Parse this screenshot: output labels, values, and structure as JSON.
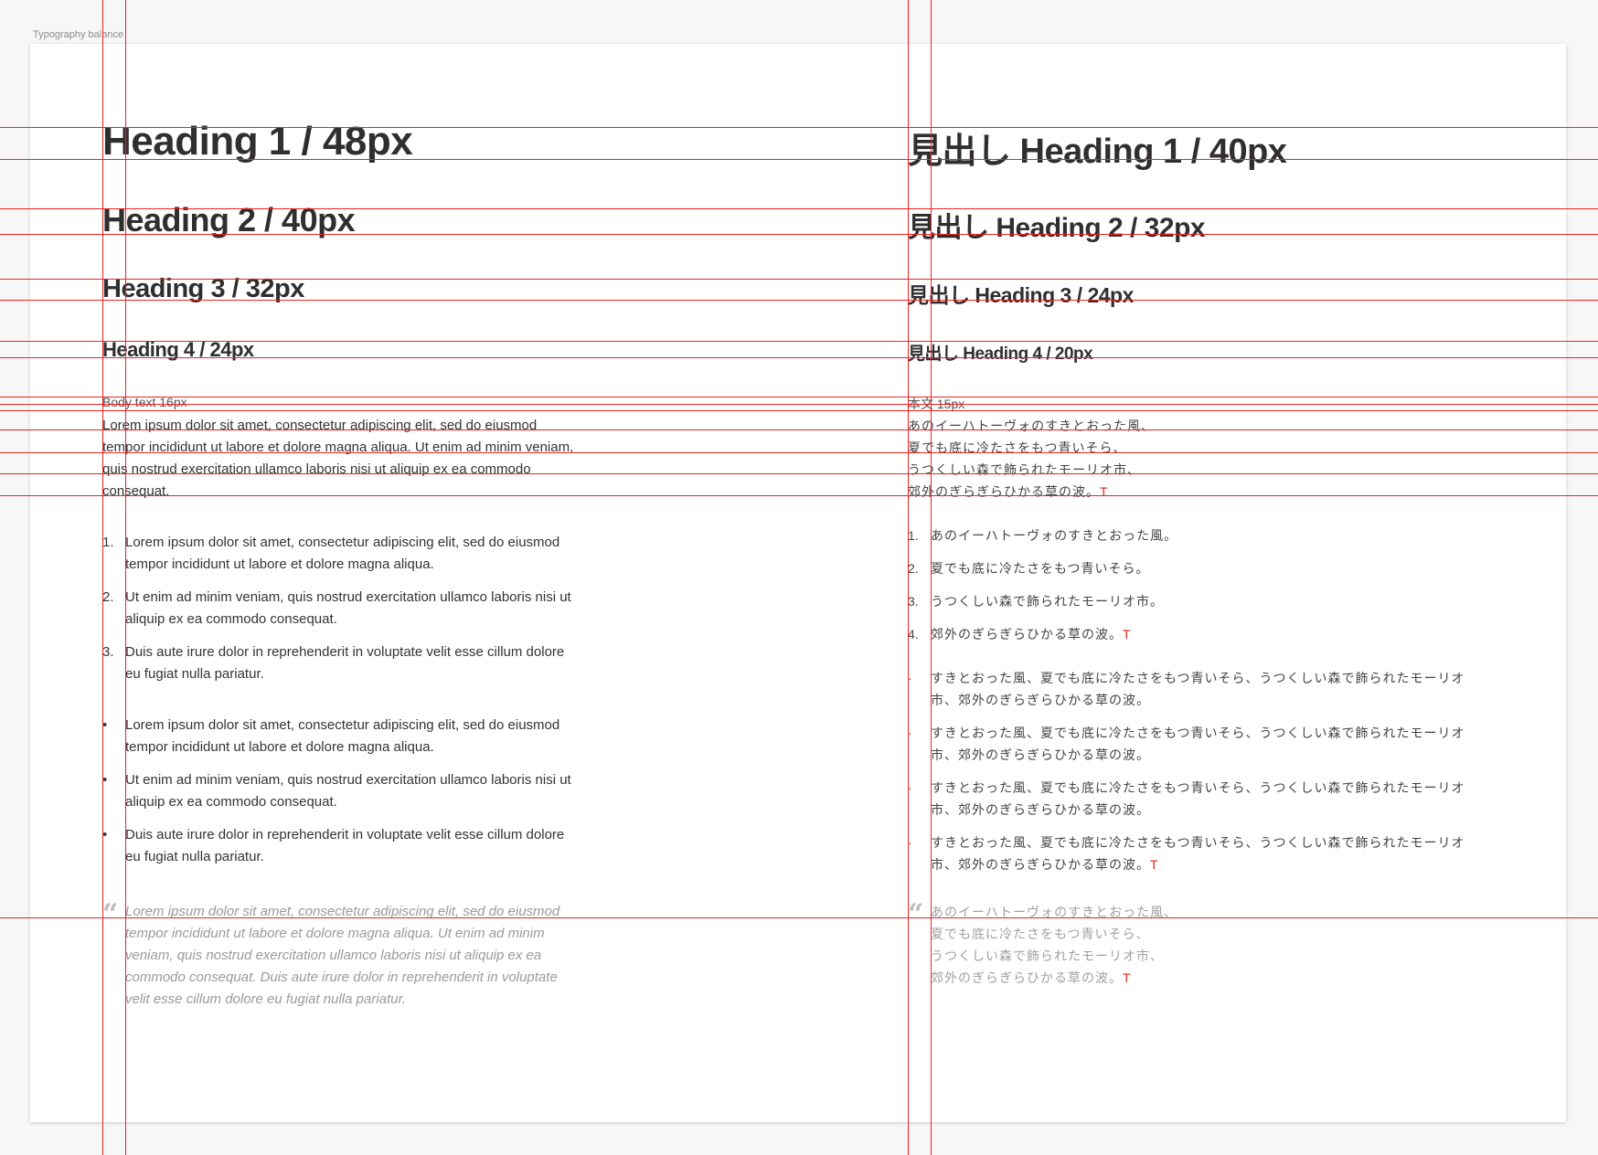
{
  "frame": {
    "label": "Typography balance"
  },
  "colors": {
    "guide": "#ee2222",
    "text": "#333333",
    "quote": "#9a9a9a",
    "accent": "#e0261b"
  },
  "left": {
    "h1": "Heading 1 / 48px",
    "h2": "Heading 2 / 40px",
    "h3": "Heading 3 / 32px",
    "h4": "Heading 4 / 24px",
    "body_label": "Body text 16px",
    "body": "Lorem ipsum dolor sit amet, consectetur adipiscing elit, sed do eiusmod tempor incididunt ut labore et dolore magna aliqua. Ut enim ad minim veniam, quis nostrud exercitation ullamco laboris nisi ut aliquip ex ea commodo consequat.",
    "ordered": [
      {
        "marker": "1.",
        "text": "Lorem ipsum dolor sit amet, consectetur adipiscing elit, sed do eiusmod tempor incididunt ut labore et dolore magna aliqua."
      },
      {
        "marker": "2.",
        "text": "Ut enim ad minim veniam, quis nostrud exercitation ullamco laboris nisi ut aliquip ex ea commodo consequat."
      },
      {
        "marker": "3.",
        "text": "Duis aute irure dolor in reprehenderit in voluptate velit esse cillum dolore eu fugiat nulla pariatur."
      }
    ],
    "bullets": [
      {
        "marker": "•",
        "text": "Lorem ipsum dolor sit amet, consectetur adipiscing elit, sed do eiusmod tempor incididunt ut labore et dolore magna aliqua."
      },
      {
        "marker": "•",
        "text": "Ut enim ad minim veniam, quis nostrud exercitation ullamco laboris nisi ut aliquip ex ea commodo consequat."
      },
      {
        "marker": "•",
        "text": "Duis aute irure dolor in reprehenderit in voluptate velit esse cillum dolore eu fugiat nulla pariatur."
      }
    ],
    "quote_mark": "“",
    "quote": "Lorem ipsum dolor sit amet, consectetur adipiscing elit, sed do eiusmod tempor incididunt ut labore et dolore magna aliqua. Ut enim ad minim veniam, quis nostrud exercitation ullamco laboris nisi ut aliquip ex ea commodo consequat. Duis aute irure dolor in reprehenderit in voluptate velit esse cillum dolore eu fugiat nulla pariatur."
  },
  "right": {
    "h1": "見出し Heading 1 / 40px",
    "h2": "見出し Heading 2 / 32px",
    "h3": "見出し Heading 3 / 24px",
    "h4": "見出し Heading 4 / 20px",
    "body_label": "本文 15px",
    "body_lines": [
      "あのイーハトーヴォのすきとおった風、",
      "夏でも底に冷たさをもつ青いそら、",
      "うつくしい森で飾られたモーリオ市、",
      "郊外のぎらぎらひかる草の波。"
    ],
    "t_mark": "T",
    "ordered": [
      {
        "marker": "1.",
        "text": "あのイーハトーヴォのすきとおった風。"
      },
      {
        "marker": "2.",
        "text": "夏でも底に冷たさをもつ青いそら。"
      },
      {
        "marker": "3.",
        "text": "うつくしい森で飾られたモーリオ市。"
      },
      {
        "marker": "4.",
        "text": "郊外のぎらぎらひかる草の波。"
      }
    ],
    "bullets": [
      {
        "marker": "·",
        "text": "すきとおった風、夏でも底に冷たさをもつ青いそら、うつくしい森で飾られたモーリオ市、郊外のぎらぎらひかる草の波。"
      },
      {
        "marker": "·",
        "text": "すきとおった風、夏でも底に冷たさをもつ青いそら、うつくしい森で飾られたモーリオ市、郊外のぎらぎらひかる草の波。"
      },
      {
        "marker": "·",
        "text": "すきとおった風、夏でも底に冷たさをもつ青いそら、うつくしい森で飾られたモーリオ市、郊外のぎらぎらひかる草の波。"
      },
      {
        "marker": "·",
        "text": "すきとおった風、夏でも底に冷たさをもつ青いそら、うつくしい森で飾られたモーリオ市、郊外のぎらぎらひかる草の波。"
      }
    ],
    "quote_mark": "“",
    "quote_lines": [
      "あのイーハトーヴォのすきとおった風、",
      "夏でも底に冷たさをもつ青いそら、",
      "うつくしい森で飾られたモーリオ市、",
      "郊外のぎらぎらひかる草の波。"
    ]
  }
}
